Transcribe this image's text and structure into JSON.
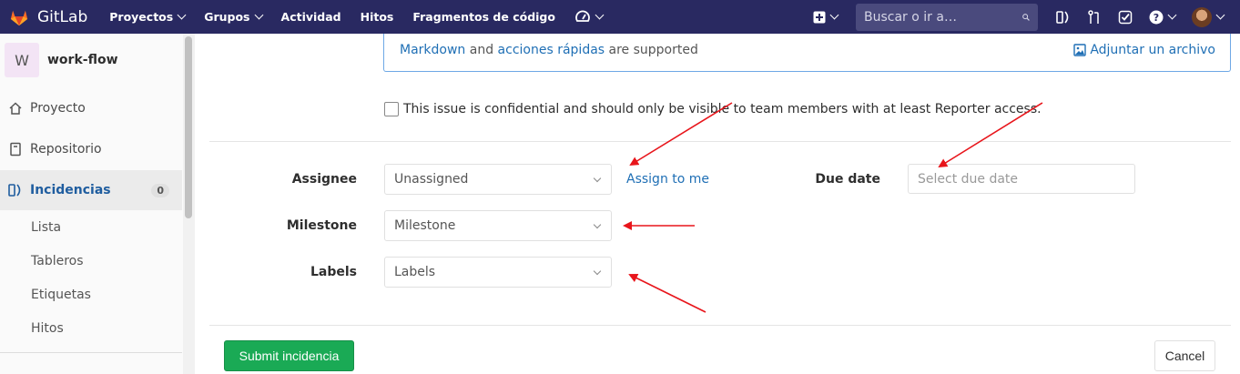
{
  "navbar": {
    "brand": "GitLab",
    "links": [
      "Proyectos",
      "Grupos",
      "Actividad",
      "Hitos",
      "Fragmentos de código"
    ],
    "search_placeholder": "Buscar o ir a…",
    "icons": [
      "gitlab-logo",
      "gauge-icon",
      "plus-icon",
      "search-icon",
      "issues-icon",
      "merge-request-icon",
      "todo-icon",
      "help-icon",
      "user-avatar"
    ]
  },
  "sidebar": {
    "project_initial": "W",
    "project_name": "work-flow",
    "items": [
      {
        "label": "Proyecto",
        "icon": "home-icon"
      },
      {
        "label": "Repositorio",
        "icon": "repository-icon"
      },
      {
        "label": "Incidencias",
        "icon": "issues-icon",
        "badge": "0"
      }
    ],
    "sub_items": [
      "Lista",
      "Tableros",
      "Etiquetas",
      "Hitos"
    ]
  },
  "form": {
    "markdown_help": {
      "link1": "Markdown",
      "and": " and ",
      "link2": "acciones rápidas",
      "suffix": " are supported"
    },
    "attach_label": "Adjuntar un archivo",
    "confidential_label": "This issue is confidential and should only be visible to team members with at least Reporter access.",
    "assignee_label": "Assignee",
    "assignee_value": "Unassigned",
    "assign_to_me": "Assign to me",
    "due_date_label": "Due date",
    "due_date_placeholder": "Select due date",
    "milestone_label": "Milestone",
    "milestone_value": "Milestone",
    "labels_label": "Labels",
    "labels_value": "Labels",
    "submit_label": "Submit incidencia",
    "cancel_label": "Cancel"
  },
  "colors": {
    "navbar": "#292961",
    "link": "#1f6fb5",
    "submit": "#1aaa55",
    "annotation_arrow": "#e8151b"
  }
}
